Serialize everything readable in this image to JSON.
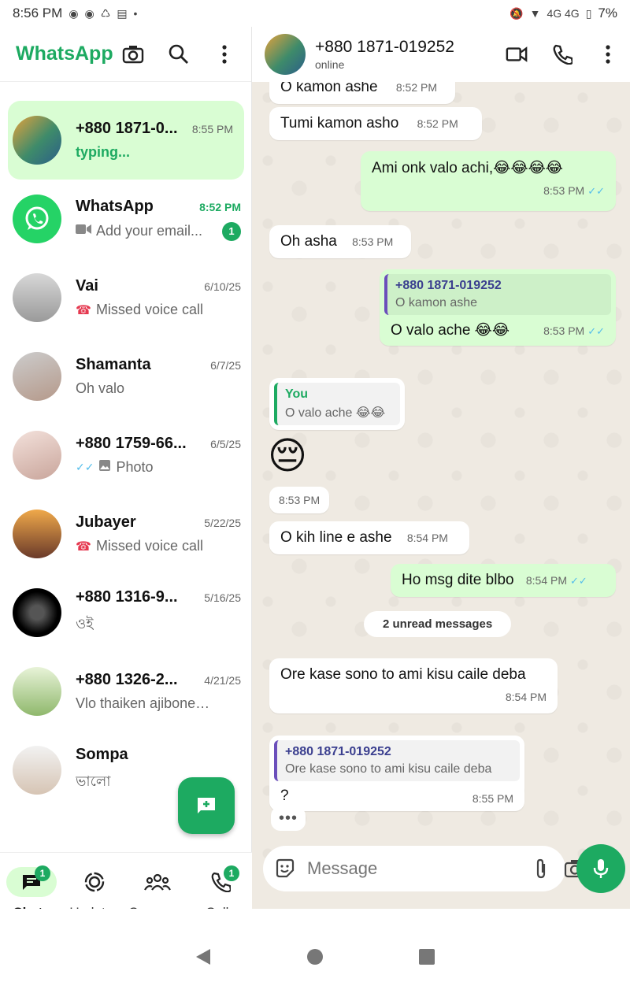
{
  "status_bar": {
    "time": "8:56 PM",
    "battery": "7%",
    "network": "4G  4G"
  },
  "app": {
    "brand": "WhatsApp"
  },
  "chats": [
    {
      "name": "+880 1871-0...",
      "time": "8:55 PM",
      "preview": "typing...",
      "active": true
    },
    {
      "name": "WhatsApp",
      "time": "8:52 PM",
      "preview": "Add your email...",
      "badge": "1"
    },
    {
      "name": "Vai",
      "time": "6/10/25",
      "preview": "Missed voice call"
    },
    {
      "name": "Shamanta",
      "time": "6/7/25",
      "preview": "Oh valo"
    },
    {
      "name": "+880 1759-66...",
      "time": "6/5/25",
      "preview": "Photo"
    },
    {
      "name": "Jubayer",
      "time": "5/22/25",
      "preview": "Missed voice call"
    },
    {
      "name": "+880 1316-9...",
      "time": "5/16/25",
      "preview": "ওই"
    },
    {
      "name": "+880 1326-2...",
      "time": "4/21/25",
      "preview": "Vlo thaiken ajiboner j..."
    },
    {
      "name": "Sompa",
      "time": "",
      "preview": "ভালো"
    }
  ],
  "bottom_nav": {
    "chats": "Chats",
    "updates": "Updates",
    "communities": "Commu...",
    "calls": "Calls",
    "chats_badge": "1",
    "calls_badge": "1"
  },
  "conversation": {
    "contact": "+880 1871-019252",
    "status": "online",
    "messages": [
      {
        "text": "O kamon ashe",
        "time": "8:52 PM"
      },
      {
        "text": "Tumi kamon asho",
        "time": "8:52 PM"
      },
      {
        "text": "Ami onk valo achi,😂😂😂😂",
        "time": "8:53 PM"
      },
      {
        "text": "Oh asha",
        "time": "8:53 PM"
      },
      {
        "quote_name": "+880 1871-019252",
        "quote_text": "O kamon ashe",
        "text": "O valo ache 😂😂",
        "time": "8:53 PM"
      },
      {
        "quote_name": "You",
        "quote_text": "O valo ache 😂😂",
        "emoji": "😔",
        "time": "8:53 PM"
      },
      {
        "text": "O kih line e ashe",
        "time": "8:54 PM"
      },
      {
        "text": "Ho msg dite blbo",
        "time": "8:54 PM"
      },
      {
        "text": "Ore kase sono to ami kisu caile deba",
        "time": "8:54 PM"
      },
      {
        "quote_name": "+880 1871-019252",
        "quote_text": "Ore kase sono to ami kisu caile deba",
        "text": "?",
        "time": "8:55 PM"
      }
    ],
    "unread_label": "2 unread messages",
    "typing_indicator": "•••",
    "ticks": "✓✓"
  },
  "composer": {
    "placeholder": "Message"
  },
  "colors": {
    "accent": "#1daa61",
    "outgoing": "#d9fdd3",
    "chat_bg": "#efeae2",
    "read_ticks": "#53bdeb"
  }
}
